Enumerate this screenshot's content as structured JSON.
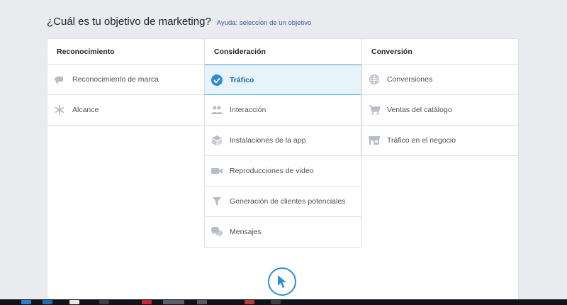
{
  "header": {
    "title": "¿Cuál es tu objetivo de marketing?",
    "help_link": "Ayuda: selección de un objetivo"
  },
  "columns": [
    {
      "heading": "Reconocimiento",
      "options": [
        {
          "label": "Reconocimiento de marca",
          "icon": "megaphone-icon"
        },
        {
          "label": "Alcance",
          "icon": "asterisk-icon"
        }
      ]
    },
    {
      "heading": "Consideración",
      "options": [
        {
          "label": "Tráfico",
          "icon": "check-circle-icon",
          "selected": true
        },
        {
          "label": "Interacción",
          "icon": "people-icon"
        },
        {
          "label": "Instalaciones de la app",
          "icon": "cube-icon"
        },
        {
          "label": "Reproducciones de video",
          "icon": "video-camera-icon"
        },
        {
          "label": "Generación de clientes potenciales",
          "icon": "funnel-icon"
        },
        {
          "label": "Mensajes",
          "icon": "chat-bubbles-icon"
        }
      ]
    },
    {
      "heading": "Conversión",
      "options": [
        {
          "label": "Conversiones",
          "icon": "globe-icon"
        },
        {
          "label": "Ventas del catálogo",
          "icon": "shopping-cart-icon"
        },
        {
          "label": "Tráfico en el negocio",
          "icon": "storefront-icon"
        }
      ]
    }
  ],
  "colors": {
    "accent": "#2d8fd5",
    "selected_bg": "#e6f4fa",
    "icon_gray": "#b7bdc8"
  }
}
